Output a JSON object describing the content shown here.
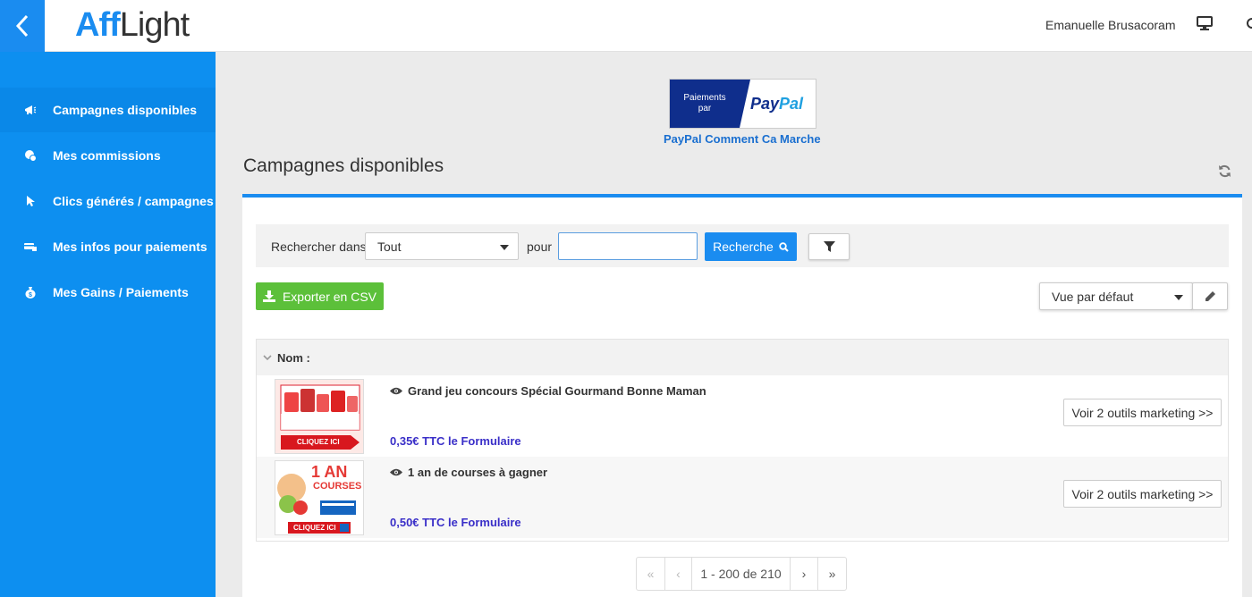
{
  "app": {
    "logo_aff": "Aff",
    "logo_light": "Light"
  },
  "header": {
    "user_name": "Emanuelle Brusacoram"
  },
  "sidebar": {
    "items": [
      {
        "label": "Campagnes disponibles",
        "icon": "megaphone-icon"
      },
      {
        "label": "Mes commissions",
        "icon": "coins-icon"
      },
      {
        "label": "Clics générés / campagnes",
        "icon": "cursor-icon"
      },
      {
        "label": "Mes infos pour paiements",
        "icon": "card-icon"
      },
      {
        "label": "Mes Gains / Paiements",
        "icon": "money-bag-icon"
      }
    ]
  },
  "banner": {
    "paiements": "Paiements",
    "par": "par",
    "pay": "Pay",
    "pal": "Pal",
    "link": "PayPal Comment Ca Marche"
  },
  "main": {
    "title": "Campagnes disponibles"
  },
  "search": {
    "label_in": "Rechercher dans",
    "scope_value": "Tout",
    "label_for": "pour",
    "query_value": "",
    "button": "Recherche"
  },
  "toolbar": {
    "export_label": "Exporter en CSV",
    "view_value": "Vue par défaut"
  },
  "table": {
    "header": "Nom :",
    "rows": [
      {
        "title": "Grand jeu concours Spécial Gourmand Bonne Maman",
        "price": "0,35€ TTC le Formulaire",
        "button": "Voir 2 outils marketing >>",
        "thumb_cta": "CLIQUEZ ICI"
      },
      {
        "title": "1 an de courses à gagner",
        "price": "0,50€ TTC le Formulaire",
        "button": "Voir 2 outils marketing >>",
        "thumb_big": "1 AN",
        "thumb_sub": "COURSES",
        "thumb_cta": "CLIQUEZ ICI"
      }
    ]
  },
  "pagination": {
    "first": "«",
    "prev": "‹",
    "range": "1 - 200 de 210",
    "next": "›",
    "last": "»"
  },
  "colors": {
    "primary": "#1a8cf0",
    "success": "#5cc03a",
    "price": "#3a2fc8",
    "paypal_navy": "#0f2e8c"
  }
}
